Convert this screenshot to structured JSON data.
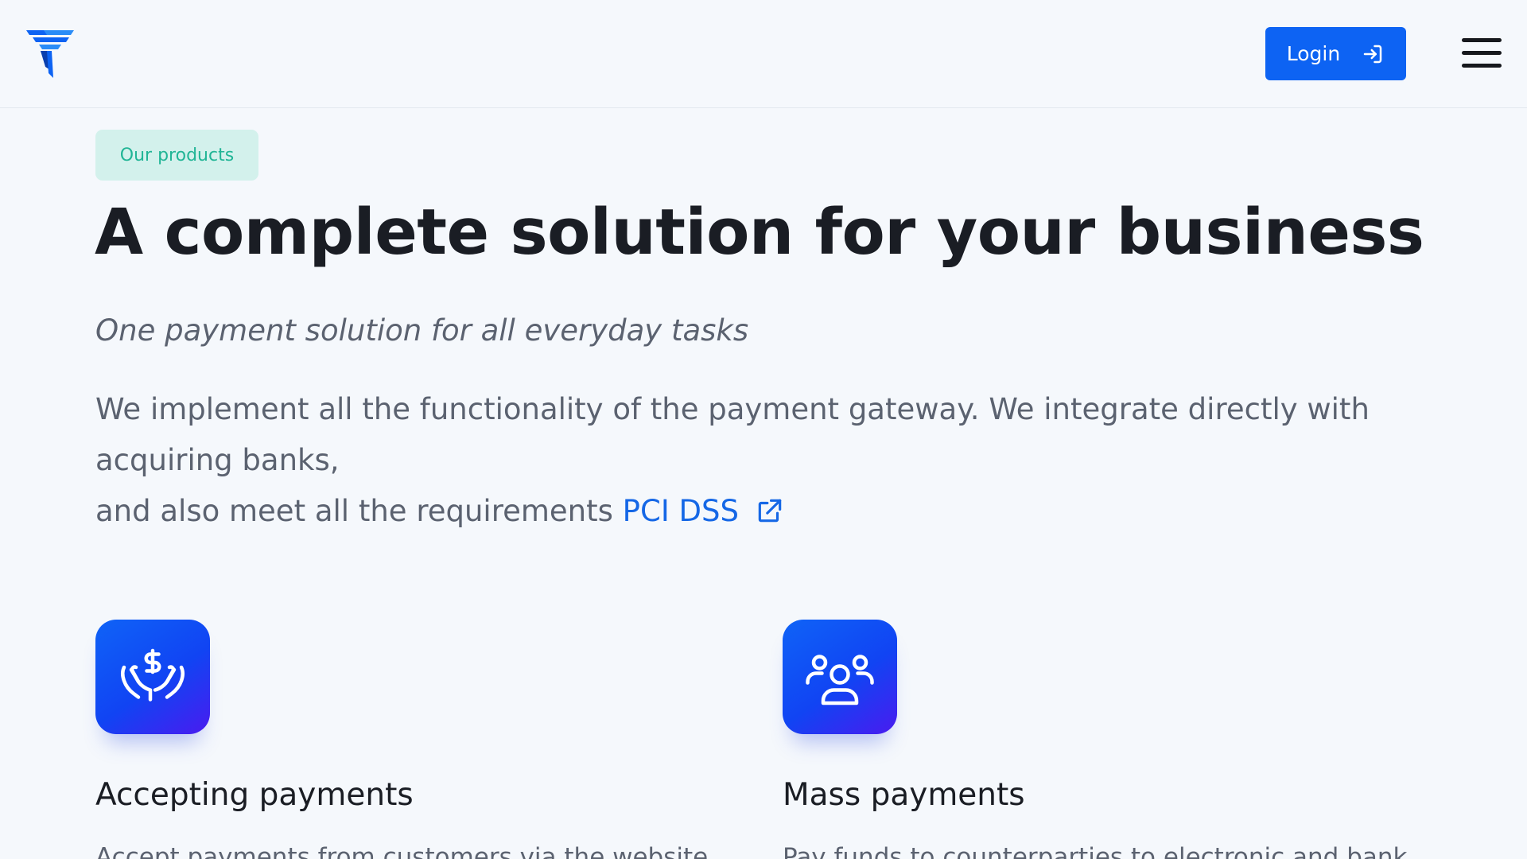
{
  "header": {
    "login_label": "Login"
  },
  "hero": {
    "pill_label": "Our products",
    "title": "A complete solution for your business",
    "subtitle": "One payment solution for all everyday tasks",
    "desc_line1": "We implement all the functionality of the payment gateway. We integrate directly with",
    "desc_line2": "acquiring banks,",
    "desc_line3": "and also meet all the requirements ",
    "link_label": "PCI DSS"
  },
  "products": [
    {
      "title": "Accepting payments",
      "text": "Accept payments from customers via the website",
      "icon": "hand-dollar-icon"
    },
    {
      "title": "Mass payments",
      "text": "Pay funds to counterparties to electronic and bank",
      "icon": "users-group-icon"
    }
  ],
  "colors": {
    "accent": "#0d63f3",
    "pill_bg": "#d3f1ec",
    "pill_text": "#21b596",
    "background": "#f5f8fc"
  }
}
